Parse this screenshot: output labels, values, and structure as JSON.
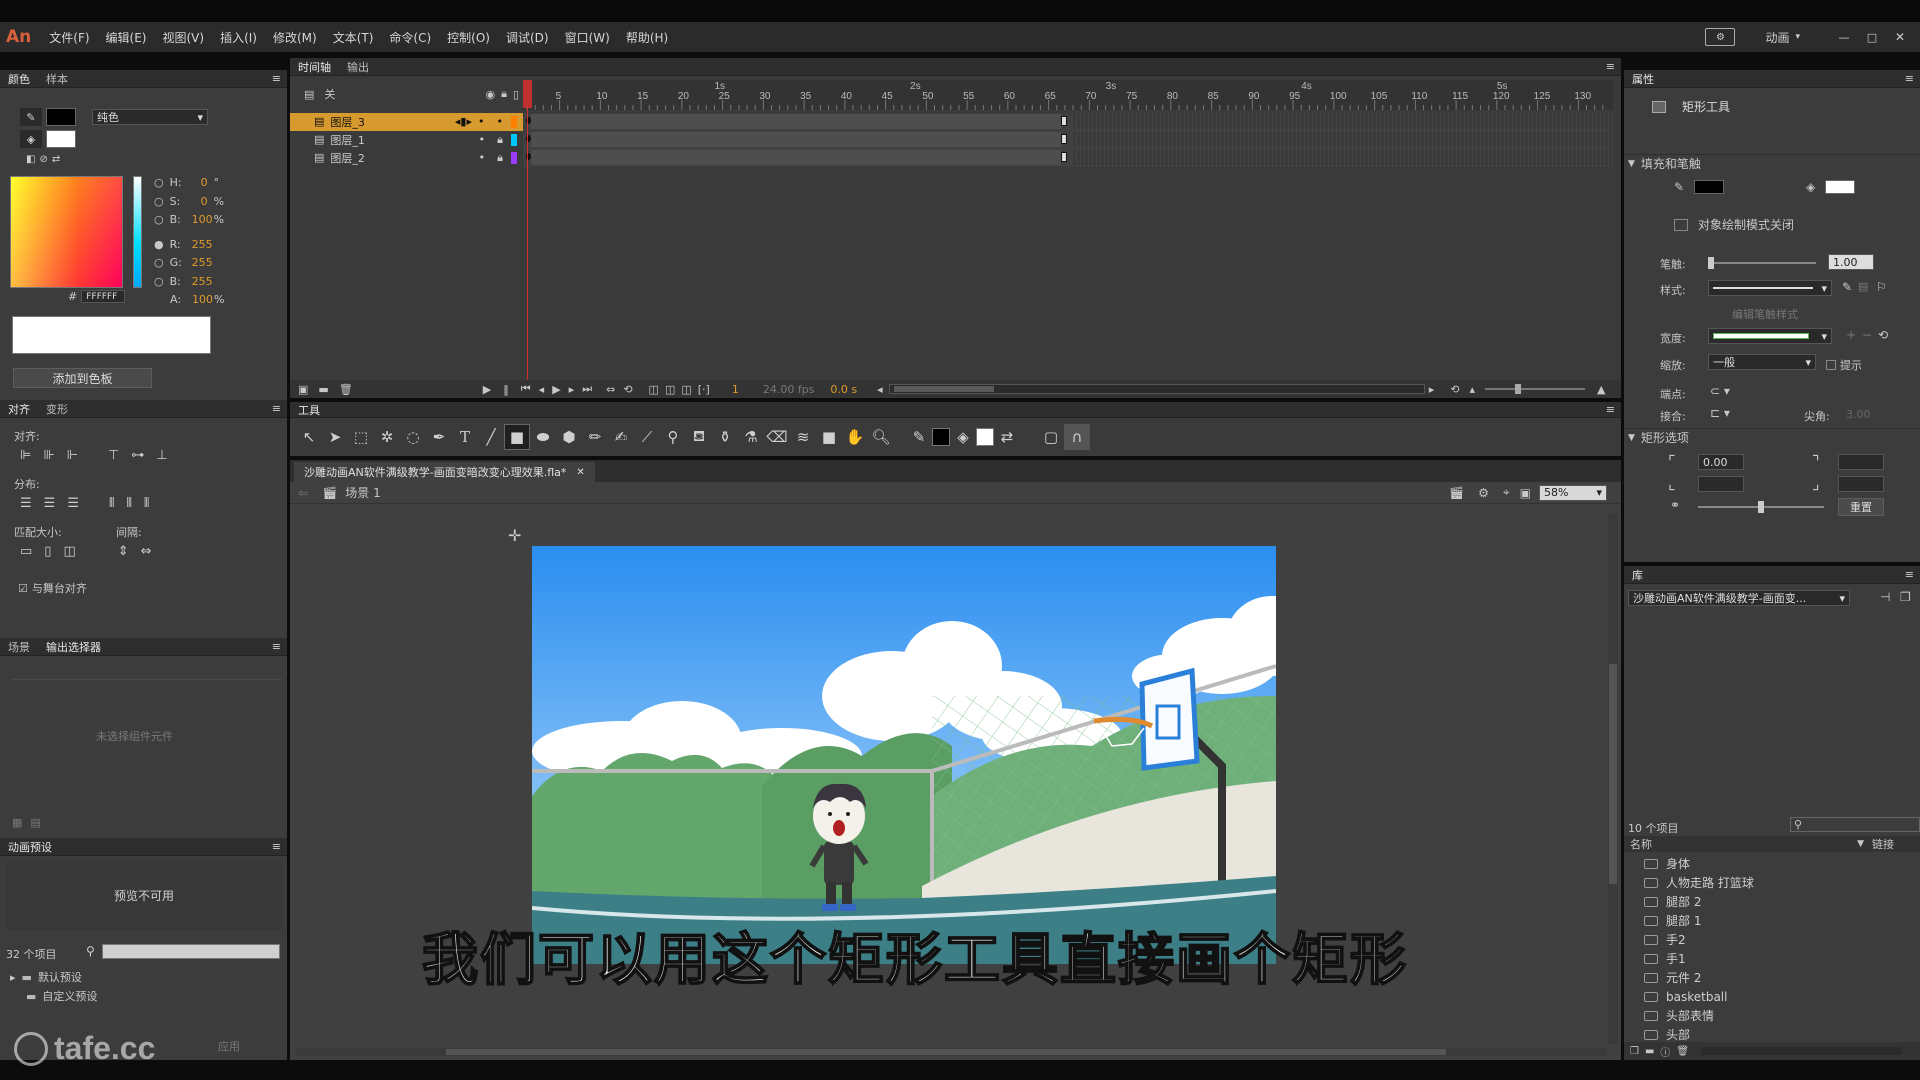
{
  "app": {
    "logo": "An",
    "menu": [
      "文件(F)",
      "编辑(E)",
      "视图(V)",
      "插入(I)",
      "修改(M)",
      "文本(T)",
      "命令(C)",
      "控制(O)",
      "调试(D)",
      "窗口(W)",
      "帮助(H)"
    ],
    "workspace": "动画",
    "window_controls": [
      "—",
      "□",
      "✕"
    ]
  },
  "color_panel": {
    "tabs": [
      "颜色",
      "样本"
    ],
    "type": "纯色",
    "h": "0",
    "h_unit": "°",
    "s": "0",
    "s_unit": "%",
    "b": "100",
    "b_unit": "%",
    "r": "255",
    "g": "255",
    "bl": "255",
    "hex": "FFFFFF",
    "alpha": "100",
    "alpha_unit": "%",
    "h_label": "H:",
    "s_label": "S:",
    "b_label": "B:",
    "r_label": "R:",
    "g_label": "G:",
    "bl_label": "B:",
    "a_label": "A:",
    "hash": "#",
    "add_swatch": "添加到色板"
  },
  "align_panel": {
    "tabs": [
      "对齐",
      "变形"
    ],
    "align": "对齐:",
    "distribute": "分布:",
    "match_size": "匹配大小:",
    "spacing": "间隔:",
    "to_stage": "与舞台对齐"
  },
  "scene_panel": {
    "tabs": [
      "场景",
      "输出选择器"
    ],
    "empty": "未选择组件元件"
  },
  "motion_presets": {
    "title": "动画预设",
    "preview": "预览不可用",
    "count": "32 个项目",
    "folders": [
      "默认预设",
      "自定义预设"
    ],
    "apply": "应用"
  },
  "timeline": {
    "tabs": [
      "时间轴",
      "输出"
    ],
    "header_label": "关",
    "layers": [
      {
        "name": "图层_3",
        "selected": true,
        "color": "#ff7f00"
      },
      {
        "name": "图层_1",
        "selected": false,
        "color": "#00c6ff"
      },
      {
        "name": "图层_2",
        "selected": false,
        "color": "#9a3cff"
      }
    ],
    "seconds": [
      "1s",
      "2s",
      "3s",
      "4s",
      "5s"
    ],
    "frames": [
      "5",
      "10",
      "15",
      "20",
      "25",
      "30",
      "35",
      "40",
      "45",
      "50",
      "55",
      "60",
      "65",
      "70",
      "75",
      "80",
      "85",
      "90",
      "95",
      "100",
      "105",
      "110",
      "115",
      "120",
      "125",
      "130"
    ],
    "current_frame": "1",
    "fps": "24.00 fps",
    "time": "0.0 s"
  },
  "tools_panel": {
    "title": "工具"
  },
  "document": {
    "tab": "沙雕动画AN软件满级教学-画面变暗改变心理效果.fla*",
    "scene": "场景 1",
    "zoom": "58%"
  },
  "subtitle": "我们可以用这个矩形工具直接画个矩形",
  "watermark": "tafe.cc",
  "properties": {
    "tab": "属性",
    "tool_name": "矩形工具",
    "fill_stroke": "填充和笔触",
    "object_draw": "对象绘制模式关闭",
    "stroke_label": "笔触:",
    "stroke_value": "1.00",
    "style_label": "样式:",
    "width_label": "宽度:",
    "scale_label": "缩放:",
    "scale_value": "一般",
    "hint": "提示",
    "cap_label": "端点:",
    "join_label": "接合:",
    "miter_label": "尖角:",
    "miter_value": "3.00",
    "edit_style": "编辑笔触样式",
    "rect_options": "矩形选项",
    "corner_value": "0.00",
    "reset": "重置",
    "stroke_color": "#000000",
    "fill_color": "#ffffff"
  },
  "library": {
    "tab": "库",
    "doc": "沙雕动画AN软件满级教学-画面变...",
    "count": "10 个项目",
    "col_name": "名称",
    "col_link": "链接",
    "items": [
      "身体",
      "人物走路 打篮球",
      "腿部 2",
      "腿部 1",
      "手2",
      "手1",
      "元件 2",
      "basketball",
      "头部表情",
      "头部"
    ]
  }
}
